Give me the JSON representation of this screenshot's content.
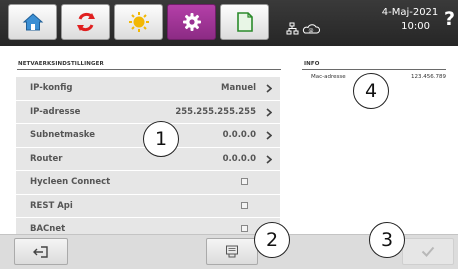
{
  "datetime": {
    "date": "4-Maj-2021",
    "time": "10:00"
  },
  "help_label": "?",
  "network_section": {
    "title": "NETVAERKSINDSTILLINGER",
    "rows": [
      {
        "label": "IP-konfig",
        "value": "Manuel",
        "kind": "chevron"
      },
      {
        "label": "IP-adresse",
        "value": "255.255.255.255",
        "kind": "chevron"
      },
      {
        "label": "Subnetmaske",
        "value": "0.0.0.0",
        "kind": "chevron"
      },
      {
        "label": "Router",
        "value": "0.0.0.0",
        "kind": "chevron"
      },
      {
        "label": "Hycleen Connect",
        "value": "",
        "kind": "checkbox",
        "checked": false
      },
      {
        "label": "REST Api",
        "value": "",
        "kind": "checkbox",
        "checked": false
      },
      {
        "label": "BACnet",
        "value": "",
        "kind": "checkbox",
        "checked": false
      }
    ]
  },
  "info_section": {
    "title": "INFO",
    "mac_label": "Mac-adresse",
    "mac_value": "123.456.789"
  },
  "callouts": [
    "1",
    "2",
    "3",
    "4"
  ],
  "icons": {
    "tabs": [
      "home-icon",
      "circulation-arrows-icon",
      "sun-icon",
      "gear-icon",
      "file-icon"
    ],
    "network": "network-cloud-icon",
    "bottom": [
      "exit-icon",
      "document-icon",
      "checkmark-icon"
    ]
  },
  "colors": {
    "active_tab": "#a0359a",
    "topbar": "#2e2e2e",
    "row_bg": "#e6e6e6"
  }
}
